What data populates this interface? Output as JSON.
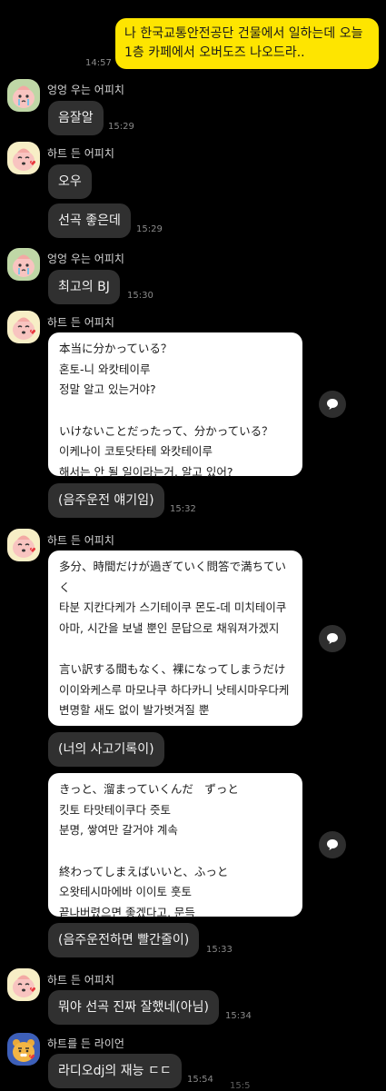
{
  "sent": {
    "lines": [
      "나 한국교통안전공단 건물에서 일하는데 오늘",
      "1층 카페에서 오버도즈 나오드라.."
    ],
    "time": "14:57"
  },
  "senders": {
    "crying": "엉엉 우는 어피치",
    "heart": "하트 든 어피치",
    "ryan": "하트를 든 라이언"
  },
  "msgs": {
    "m1": {
      "text": "음잘알",
      "time": "15:29"
    },
    "m2": {
      "text": "오우"
    },
    "m3": {
      "text": "선곡 좋은데",
      "time": "15:29"
    },
    "m4": {
      "text": "최고의 BJ",
      "time": "15:30"
    },
    "m5": {
      "lines": [
        "本当に分かっている？",
        "혼토-니 와캇테이루",
        "정말 알고 있는거야?",
        "",
        "いけないことだったって、分かっている？",
        "이케나이 코토닷타테 와캇테이루",
        "해서는 안 될 일이라는거, 알고 있어?"
      ]
    },
    "m6": {
      "text": "(음주운전 얘기임)",
      "time": "15:32"
    },
    "m7": {
      "lines": [
        "多分、時間だけが過ぎていく問答で満ちてい",
        "く",
        "타분 지칸다케가 스기테이쿠 몬도-데 미치테이쿠",
        "아마, 시간을 보낼 뿐인 문답으로 채워져가겠지",
        "",
        "言い訳する間もなく、裸になってしまうだけ",
        "이이와케스루 마모나쿠 하다카니 낫테시마우다케",
        "변명할 새도 없이 발가벗겨질 뿐"
      ]
    },
    "m8": {
      "text": "(너의 사고기록이)"
    },
    "m9": {
      "lines": [
        "きっと、溜まっていくんだ　ずっと",
        "킷토 타맛테이쿠다 즛토",
        "분명, 쌓여만 갈거야 계속",
        "",
        "終わってしまえばいいと、ふっと",
        "오왓테시마에바 이이토 훗토",
        "끝나버렸으면 좋겠다고, 문득"
      ]
    },
    "m10": {
      "text": "(음주운전하면 빨간줄이)",
      "time": "15:33"
    },
    "m11": {
      "text": "뭐야 선곡 진짜 잘했네(아님)",
      "time": "15:34"
    },
    "m12": {
      "text": "라디오dj의 재능 ㄷㄷ",
      "time": "15:54",
      "time2": "15:5"
    }
  },
  "icons": {
    "peach": "peach-avatar-icon",
    "ryan": "ryan-avatar-icon",
    "share": "share-icon"
  }
}
